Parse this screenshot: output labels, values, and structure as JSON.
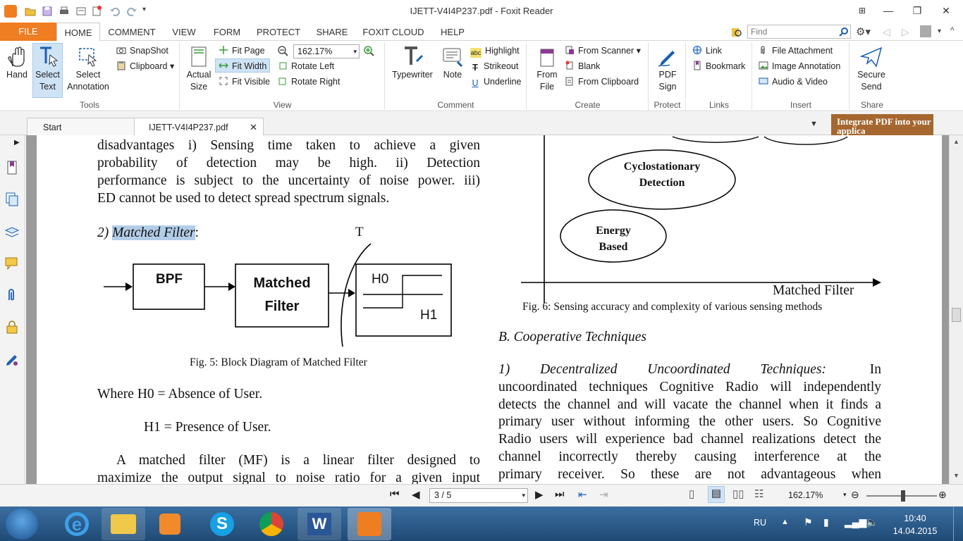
{
  "app": {
    "title": "IJETT-V4I4P237.pdf - Foxit Reader",
    "file_tab": "FILE"
  },
  "ribbon_tabs": [
    "HOME",
    "COMMENT",
    "VIEW",
    "FORM",
    "PROTECT",
    "SHARE",
    "FOXIT CLOUD",
    "HELP"
  ],
  "search": {
    "placeholder": "Find"
  },
  "ribbon": {
    "tools": {
      "label": "Tools",
      "hand": "Hand",
      "select_text": "Select Text",
      "select_annotation": "Select Annotation",
      "snapshot": "SnapShot",
      "clipboard": "Clipboard"
    },
    "view": {
      "label": "View",
      "actual_size": "Actual Size",
      "fit_page": "Fit Page",
      "fit_width": "Fit Width",
      "fit_visible": "Fit Visible",
      "zoom_value": "162.17%",
      "rotate_left": "Rotate Left",
      "rotate_right": "Rotate Right"
    },
    "comment": {
      "label": "Comment",
      "typewriter": "Typewriter",
      "note": "Note",
      "highlight": "Highlight",
      "strikeout": "Strikeout",
      "underline": "Underline"
    },
    "create": {
      "label": "Create",
      "from_file": "From File",
      "from_scanner": "From Scanner",
      "blank": "Blank",
      "from_clipboard": "From Clipboard"
    },
    "protect": {
      "label": "Protect",
      "pdf_sign": "PDF Sign"
    },
    "links": {
      "label": "Links",
      "link": "Link",
      "bookmark": "Bookmark"
    },
    "insert": {
      "label": "Insert",
      "file_attachment": "File Attachment",
      "image_annotation": "Image Annotation",
      "audio_video": "Audio & Video"
    },
    "share": {
      "label": "Share",
      "secure_send": "Secure Send"
    }
  },
  "doc_tabs": [
    "Start",
    "IJETT-V4I4P237.pdf"
  ],
  "ad_banner": "Integrate PDF into your applica",
  "document": {
    "left_lines": [
      "disadvantages i) Sensing time taken to achieve a given",
      "probability of detection may be high. ii) Detection",
      "performance is subject to the uncertainty of noise power. iii)",
      "ED cannot be used to detect spread spectrum signals."
    ],
    "matched_heading_prefix": "2) ",
    "matched_heading_highlight": "Matched Filter",
    "matched_heading_suffix": ":",
    "fig5": {
      "bpf": "BPF",
      "matched1": "Matched",
      "matched2": "Filter",
      "h0": "H0",
      "h1": "H1",
      "t": "T",
      "caption": "Fig. 5: Block Diagram of Matched Filter"
    },
    "where_h0": "Where H0 = Absence of User.",
    "where_h1": "H1 = Presence of User.",
    "mf_lines": [
      "A matched filter (MF) is a linear filter designed to",
      "maximize the output signal to noise ratio for a given input"
    ],
    "fig6": {
      "cyclo1": "Cyclostationary",
      "cyclo2": "Detection",
      "energy1": "Energy",
      "energy2": "Based",
      "axis_label": "Matched Filter",
      "caption": "Fig. 6: Sensing accuracy and complexity of various sensing methods"
    },
    "section_b": "B. Cooperative Techniques",
    "decentral_heading": "1) Decentralized Uncoordinated Techniques:",
    "decentral_first_word": "In",
    "right_lines": [
      "uncoordinated techniques Cognitive Radio will independently",
      "detects the channel and will vacate the channel when it finds a",
      "primary user without informing the other users. So Cognitive",
      "Radio users will experience bad channel realizations detect the",
      "channel incorrectly thereby causing interference at the",
      "primary receiver. So these are not advantageous when"
    ]
  },
  "status": {
    "page": "3 / 5",
    "zoom": "162.17%"
  },
  "taskbar": {
    "lang": "RU",
    "time": "10:40",
    "date": "14.04.2015"
  }
}
